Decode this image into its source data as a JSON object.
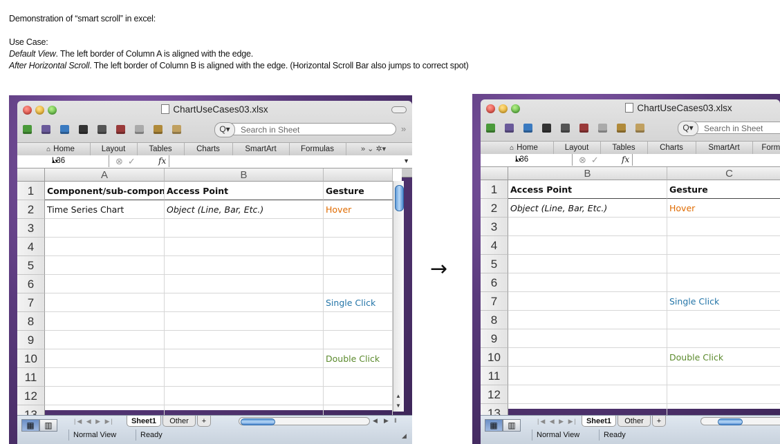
{
  "doc": {
    "title_line": "Demonstration of “smart scroll” in excel:",
    "use_case_label": "Use Case:",
    "default_view_label": "Default View",
    "default_view_text": ". The left border of Column A is aligned with the edge.",
    "after_scroll_label": "After Horizontal Scroll",
    "after_scroll_text": ".  The left border of Column B is aligned with the edge. (Horizontal Scroll Bar also jumps to correct spot)",
    "arrow": "→"
  },
  "window": {
    "title": "ChartUseCases03.xlsx",
    "search_placeholder": "Search in Sheet",
    "search_glyph": "Q▾",
    "ribbon_tabs": [
      "Home",
      "Layout",
      "Tables",
      "Charts",
      "SmartArt",
      "Formulas"
    ],
    "ribbon_tab_partial": "Formu",
    "ribbon_more": "»  ⌄  ✲▾",
    "name_box": "L36",
    "fx": "fx",
    "sheet_tabs": [
      "Sheet1",
      "Other",
      "+"
    ],
    "status": [
      "Normal View",
      "Ready"
    ],
    "icons": {
      "window": [
        "close-icon",
        "minimize-icon",
        "zoom-icon",
        "document-icon",
        "toolbar-toggle-icon"
      ],
      "toolbar": [
        "new-workbook-icon",
        "templates-icon",
        "open-icon",
        "save-icon",
        "print-icon",
        "cut-icon",
        "copy-icon",
        "paste-icon",
        "format-painter-icon"
      ],
      "ribbon": [
        "home-icon",
        "ribbon-overflow-icon",
        "ribbon-collapse-icon",
        "ribbon-settings-icon"
      ],
      "formula_bar": [
        "name-box-stepper-icon",
        "cancel-entry-icon",
        "confirm-entry-icon",
        "formula-dropdown-icon"
      ],
      "view": [
        "normal-view-icon",
        "page-layout-view-icon"
      ],
      "navigation": [
        "sheet-nav-arrows-icon",
        "scroll-left-icon",
        "scroll-right-icon",
        "scroll-up-icon",
        "scroll-down-icon",
        "split-icon",
        "resize-grip-icon"
      ]
    }
  },
  "left": {
    "columns": [
      "A",
      "B",
      ""
    ],
    "rows": [
      [
        "Component/sub-component",
        "Access Point",
        "Gesture"
      ],
      [
        "Time Series Chart",
        "Object (Line, Bar, Etc.)",
        "Hover"
      ],
      [
        "",
        "",
        ""
      ],
      [
        "",
        "",
        ""
      ],
      [
        "",
        "",
        ""
      ],
      [
        "",
        "",
        ""
      ],
      [
        "",
        "",
        "Single Click"
      ],
      [
        "",
        "",
        ""
      ],
      [
        "",
        "",
        ""
      ],
      [
        "",
        "",
        "Double Click"
      ],
      [
        "",
        "",
        ""
      ],
      [
        "",
        "",
        ""
      ]
    ],
    "row_numbers": [
      "1",
      "2",
      "3",
      "4",
      "5",
      "6",
      "7",
      "8",
      "9",
      "10",
      "11",
      "12",
      "13"
    ]
  },
  "right": {
    "columns": [
      "B",
      "C"
    ],
    "rows": [
      [
        "Access Point",
        "Gesture"
      ],
      [
        "Object (Line, Bar, Etc.)",
        "Hover"
      ],
      [
        "",
        ""
      ],
      [
        "",
        ""
      ],
      [
        "",
        ""
      ],
      [
        "",
        ""
      ],
      [
        "",
        "Single Click"
      ],
      [
        "",
        ""
      ],
      [
        "",
        ""
      ],
      [
        "",
        "Double Click"
      ],
      [
        "",
        ""
      ],
      [
        "",
        ""
      ]
    ],
    "row_numbers": [
      "1",
      "2",
      "3",
      "4",
      "5",
      "6",
      "7",
      "8",
      "9",
      "10",
      "11",
      "12",
      "13"
    ]
  },
  "colors": {
    "hover": "#e06b00",
    "single_click": "#2475a8",
    "double_click": "#5b8a2c"
  }
}
